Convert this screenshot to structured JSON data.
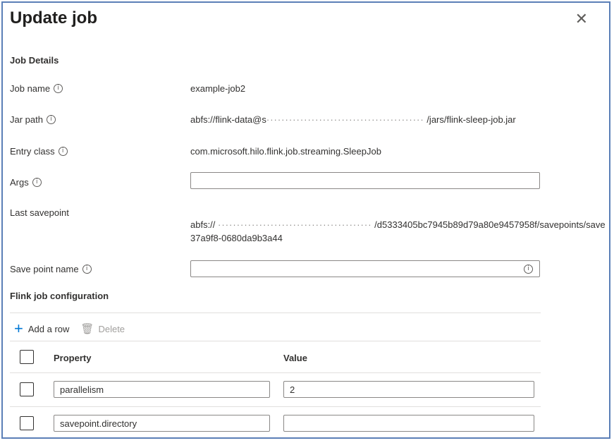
{
  "dialog": {
    "title": "Update job",
    "close_glyph": "✕"
  },
  "job_details": {
    "section_title": "Job Details",
    "job_name": {
      "label": "Job name",
      "value": "example-job2"
    },
    "jar_path": {
      "label": "Jar path",
      "prefix": "abfs://flink-data@s",
      "masked": "··········································",
      "suffix": "/jars/flink-sleep-job.jar"
    },
    "entry_class": {
      "label": "Entry class",
      "value": "com.microsoft.hilo.flink.job.streaming.SleepJob"
    },
    "args": {
      "label": "Args",
      "value": ""
    },
    "last_savepoint": {
      "label": "Last savepoint",
      "prefix": "abfs://",
      "masked": "·········································",
      "suffix": "/d5333405bc7945b89d79a80e9457958f/savepoints/save",
      "line2": "37a9f8-0680da9b3a44"
    },
    "save_point_name": {
      "label": "Save point name",
      "value": ""
    }
  },
  "flink_config": {
    "section_title": "Flink job configuration",
    "toolbar": {
      "add_label": "Add a row",
      "delete_label": "Delete"
    },
    "columns": {
      "property": "Property",
      "value": "Value"
    },
    "rows": [
      {
        "property": "parallelism",
        "value": "2"
      },
      {
        "property": "savepoint.directory",
        "value": ""
      }
    ]
  },
  "icons": {
    "info": "i",
    "plus": "+",
    "trash": "🗑"
  },
  "colors": {
    "accent": "#0078d4",
    "frame": "#5b7fb7"
  }
}
